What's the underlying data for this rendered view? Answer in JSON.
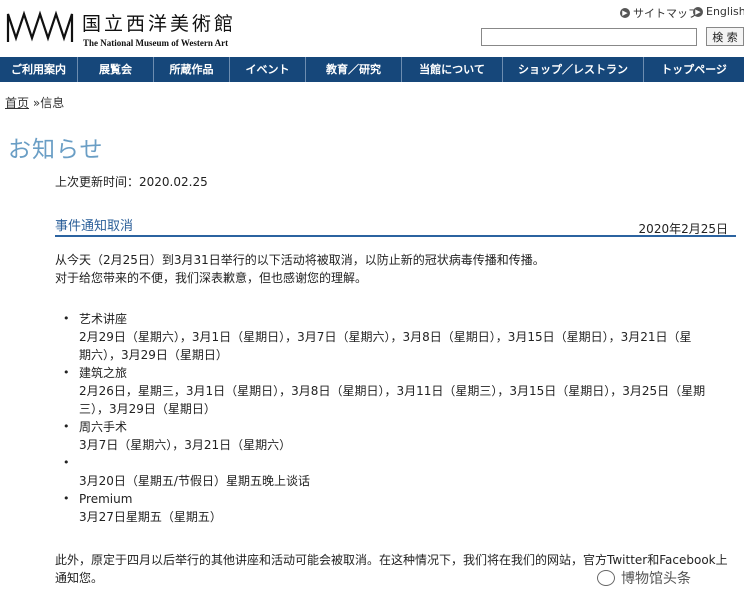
{
  "header": {
    "logo_jp": "国立西洋美術館",
    "logo_en": "The National Museum of Western Art",
    "sitemap_label": "サイトマップ",
    "english_label": "English",
    "search_placeholder": "",
    "search_button": "検 索"
  },
  "nav": {
    "items": [
      "ご利用案内",
      "展覧会",
      "所蔵作品",
      "イベント",
      "教育／研究",
      "当館について",
      "ショップ／レストラン",
      "トップページ"
    ],
    "bg_color": "#16477a"
  },
  "breadcrumb": {
    "home": "首页",
    "separator": "»",
    "current": "信息"
  },
  "page": {
    "title": "お知らせ",
    "updated": "上次更新时间：2020.02.25"
  },
  "notice": {
    "title": "事件通知取消",
    "date": "2020年2月25日",
    "intro_1": "从今天（2月25日）到3月31日举行的以下活动将被取消，以防止新的冠状病毒传播和传播。",
    "intro_2": "对于给您带来的不便，我们深表歉意，但也感谢您的理解。",
    "events": [
      {
        "name": "艺术讲座",
        "detail_1": "2月29日（星期六），3月1日（星期日），3月7日（星期六），3月8日（星期日），3月15日（星期日），3月21日（星",
        "detail_2": "期六），3月29日（星期日）"
      },
      {
        "name": "建筑之旅",
        "detail_1": "2月26日，星期三，3月1日（星期日），3月8日（星期日），3月11日（星期三），3月15日（星期日），3月25日（星期",
        "detail_2": "三），3月29日（星期日）"
      },
      {
        "name": "周六手术",
        "detail_1": "3月7日（星期六），3月21日（星期六）",
        "detail_2": ""
      },
      {
        "name": "",
        "detail_1": "3月20日（星期五/节假日）星期五晚上谈话",
        "detail_2": ""
      },
      {
        "name": "Premium",
        "detail_1": "3月27日星期五（星期五）",
        "detail_2": ""
      }
    ],
    "outro_1": "此外，原定于四月以后举行的其他讲座和活动可能会被取消。在这种情况下，我们将在我们的网站，官方Twitter和Facebook上",
    "outro_2": "通知您。"
  },
  "watermark": {
    "text": "博物馆头条"
  },
  "colors": {
    "title_blue": "#6a9ec5",
    "section_blue": "#2b5f99"
  }
}
